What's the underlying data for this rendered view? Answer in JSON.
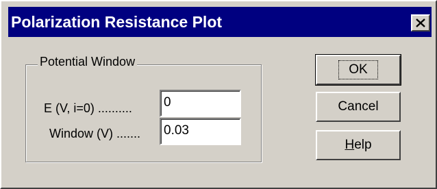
{
  "window": {
    "title": "Polarization Resistance Plot",
    "close_icon": "close-icon"
  },
  "group": {
    "legend": "Potential Window",
    "fields": [
      {
        "label": "E (V, i=0) ..........",
        "value": "0"
      },
      {
        "label": "Window (V) .......",
        "value": "0.03"
      }
    ]
  },
  "buttons": {
    "ok": "OK",
    "cancel": "Cancel",
    "help_mnemonic": "H",
    "help_rest": "elp"
  },
  "colors": {
    "titlebar": "#000080",
    "face": "#d4d0c8"
  }
}
